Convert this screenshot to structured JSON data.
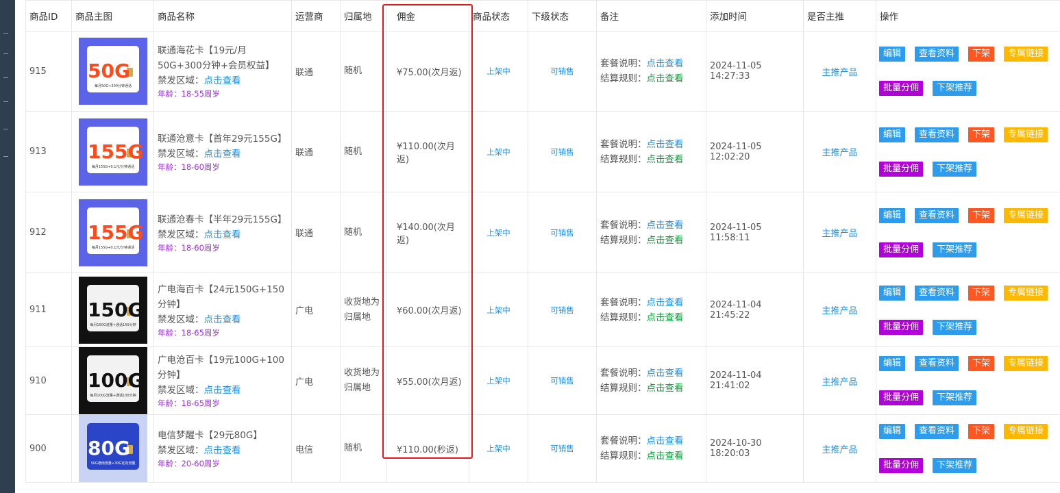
{
  "headers": {
    "id": "商品ID",
    "image": "商品主图",
    "name": "商品名称",
    "carrier": "运营商",
    "region": "归属地",
    "commission": "佣金",
    "status": "商品状态",
    "sub_status": "下级状态",
    "remark": "备注",
    "added_time": "添加时间",
    "is_main": "是否主推",
    "actions": "操作"
  },
  "labels": {
    "forbidden": "禁发区域：",
    "click_view": "点击查看",
    "plan_desc": "套餐说明：",
    "settle_rule": "结算规则："
  },
  "actions": {
    "edit": "编辑",
    "view_info": "查看资料",
    "off_shelf": "下架",
    "exclusive_link": "专属链接",
    "batch_share": "批量分佣",
    "off_recommend": "下架推荐"
  },
  "rows": [
    {
      "id": "915",
      "name": "联通海花卡【19元/月50G+300分钟+会员权益】",
      "age": "年龄：18-55周岁",
      "carrier": "联通",
      "region": "随机",
      "commission": "¥75.00(次月返)",
      "status": "上架中",
      "sub_status": "可销售",
      "added_time": "2024-11-05 14:27:33",
      "is_main": "主推产品",
      "thumb": {
        "big": "50G",
        "theme": "blue",
        "sub": "每月50G+300分钟通话"
      }
    },
    {
      "id": "913",
      "name": "联通沧意卡【首年29元155G】",
      "age": "年龄：18-60周岁",
      "carrier": "联通",
      "region": "随机",
      "commission": "¥110.00(次月返)",
      "status": "上架中",
      "sub_status": "可销售",
      "added_time": "2024-11-05 12:02:20",
      "is_main": "主推产品",
      "thumb": {
        "big": "155G",
        "theme": "blue",
        "sub": "每月155G+0.1元/分钟通话"
      }
    },
    {
      "id": "912",
      "name": "联通沧春卡【半年29元155G】",
      "age": "年龄：18-60周岁",
      "carrier": "联通",
      "region": "随机",
      "commission": "¥140.00(次月返)",
      "status": "上架中",
      "sub_status": "可销售",
      "added_time": "2024-11-05 11:58:11",
      "is_main": "主推产品",
      "thumb": {
        "big": "155G",
        "theme": "blue",
        "sub": "每月155G+0.1元/分钟通话"
      }
    },
    {
      "id": "911",
      "name": "广电海百卡【24元150G+150分钟】",
      "age": "年龄：18-65周岁",
      "carrier": "广电",
      "region": "收货地为归属地",
      "commission": "¥60.00(次月返)",
      "status": "上架中",
      "sub_status": "可销售",
      "added_time": "2024-11-04 21:45:22",
      "is_main": "主推产品",
      "thumb": {
        "big": "150G",
        "theme": "dark",
        "sub": "每月150G流量+通话150分钟"
      }
    },
    {
      "id": "910",
      "name": "广电沧百卡【19元100G+100分钟】",
      "age": "年龄：18-65周岁",
      "carrier": "广电",
      "region": "收货地为归属地",
      "commission": "¥55.00(次月返)",
      "status": "上架中",
      "sub_status": "可销售",
      "added_time": "2024-11-04 21:41:02",
      "is_main": "主推产品",
      "thumb": {
        "big": "100G",
        "theme": "dark",
        "sub": "每月100G流量+通话100分钟"
      }
    },
    {
      "id": "900",
      "name": "电信梦醒卡【29元80G】",
      "age": "年龄：20-60周岁",
      "carrier": "电信",
      "region": "随机",
      "commission": "¥110.00(秒返)",
      "status": "上架中",
      "sub_status": "可销售",
      "added_time": "2024-10-30 18:20:03",
      "is_main": "主推产品",
      "thumb": {
        "big": "80G",
        "theme": "light",
        "sub": "50G通用流量+30G定向流量"
      }
    }
  ]
}
